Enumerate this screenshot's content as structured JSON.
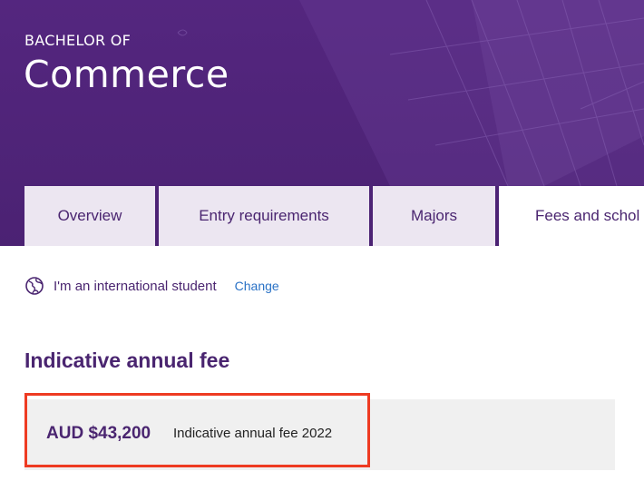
{
  "hero": {
    "kicker": "BACHELOR OF",
    "title": "Commerce"
  },
  "tabs": [
    {
      "label": "Overview",
      "active": false
    },
    {
      "label": "Entry requirements",
      "active": false
    },
    {
      "label": "Majors",
      "active": false
    },
    {
      "label": "Fees and schol",
      "active": true
    }
  ],
  "student_type": {
    "icon": "globe-icon",
    "label": "I'm an international student",
    "change_label": "Change"
  },
  "fees": {
    "heading": "Indicative annual fee",
    "amount": "AUD $43,200",
    "caption": "Indicative annual fee 2022"
  },
  "colors": {
    "brand_purple": "#54267f",
    "tab_bg": "#ece6f1",
    "link_blue": "#2a72c6",
    "highlight_red": "#ee3b22"
  }
}
